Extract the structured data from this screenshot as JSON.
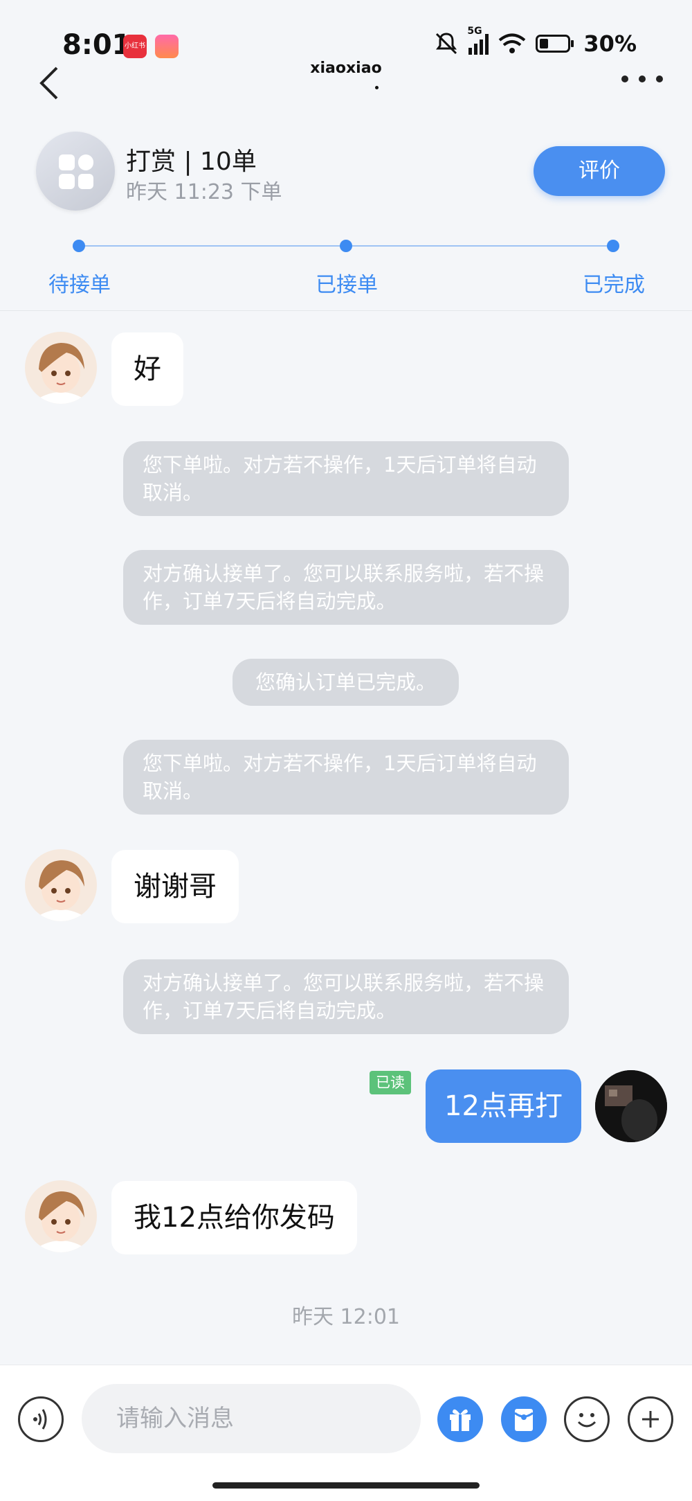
{
  "status_bar": {
    "time": "8:01",
    "app_badge": "小红书",
    "network": "5G",
    "battery_percent": "30%"
  },
  "nav": {
    "title": "xiaoxiao",
    "dot": "."
  },
  "order": {
    "title": "打赏 | 10单",
    "time": "昨天 11:23 下单",
    "review_label": "评价"
  },
  "progress": {
    "steps": [
      "待接单",
      "已接单",
      "已完成"
    ]
  },
  "messages": {
    "m1": "好",
    "s1": "您下单啦。对方若不操作，1天后订单将自动取消。",
    "s2": "对方确认接单了。您可以联系服务啦，若不操作，订单7天后将自动完成。",
    "s3": "您确认订单已完成。",
    "s4": "您下单啦。对方若不操作，1天后订单将自动取消。",
    "m2": "谢谢哥",
    "s5": "对方确认接单了。您可以联系服务啦，若不操作，订单7天后将自动完成。",
    "read_tag": "已读",
    "m_out": "12点再打",
    "m3": "我12点给你发码",
    "timestamp": "昨天 12:01"
  },
  "input": {
    "placeholder": "请输入消息"
  },
  "icons": [
    "back-icon",
    "more-icon",
    "voice-icon",
    "gift-icon",
    "red-packet-icon",
    "emoji-icon",
    "plus-icon"
  ],
  "colors": {
    "accent": "#4a8ff0",
    "system_bubble": "#d6d9de",
    "read_tag": "#5cc27a"
  }
}
